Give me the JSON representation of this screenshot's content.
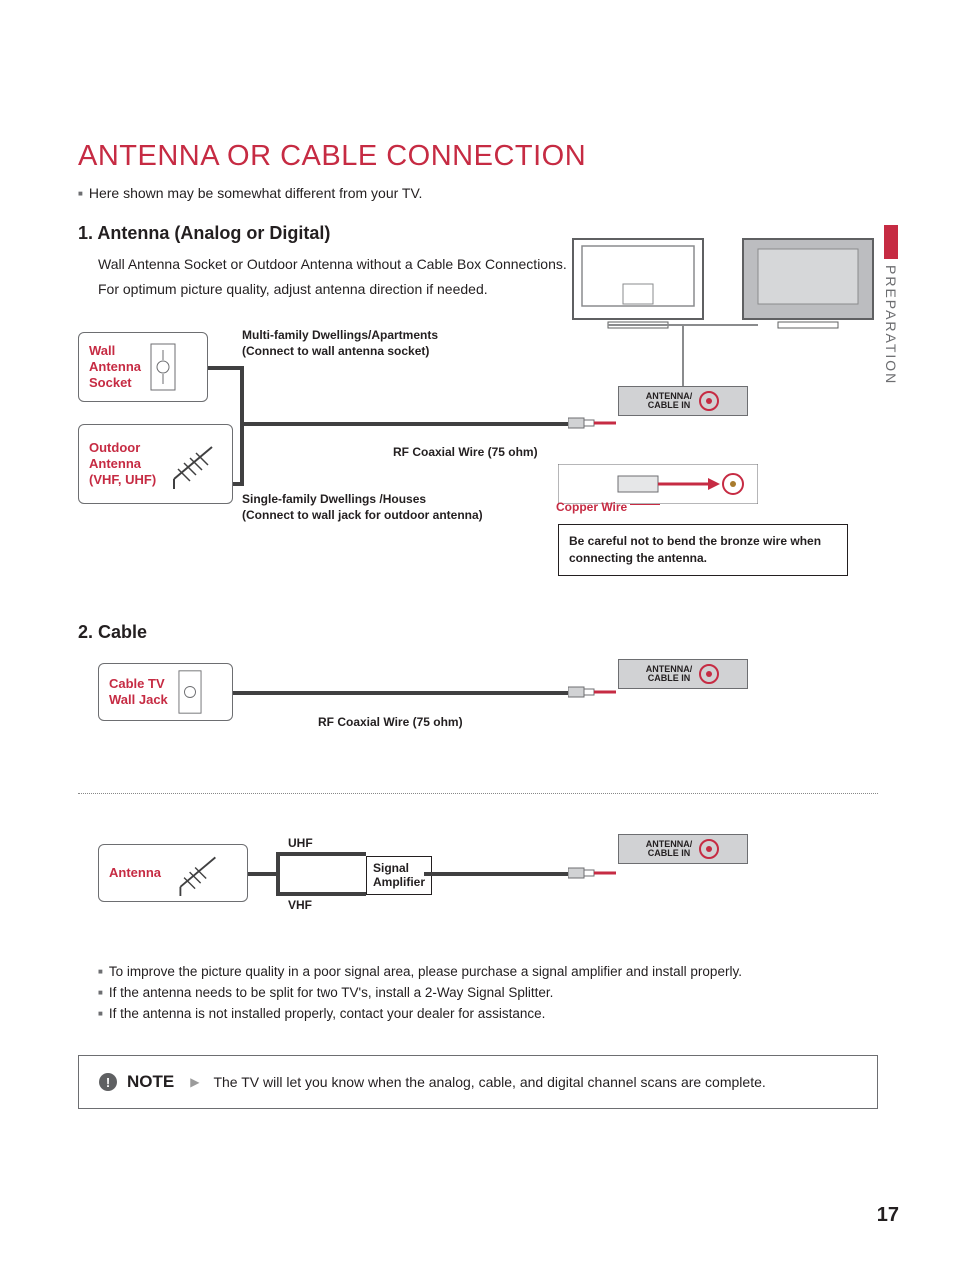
{
  "sideTab": "PREPARATION",
  "pageNumber": "17",
  "title": "ANTENNA OR CABLE CONNECTION",
  "intro": "Here shown may be somewhat different from your TV.",
  "section1": {
    "heading": "1. Antenna (Analog or Digital)",
    "p1": "Wall Antenna Socket or Outdoor Antenna without a Cable Box Connections.",
    "p2": "For optimum picture quality, adjust antenna direction if needed.",
    "labels": {
      "wallSocket": "Wall\nAntenna\nSocket",
      "outdoor": "Outdoor\nAntenna\n(VHF, UHF)",
      "multi": "Multi-family Dwellings/Apartments\n(Connect to wall antenna socket)",
      "single": "Single-family Dwellings /Houses\n(Connect to wall jack for outdoor antenna)",
      "rf": "RF Coaxial Wire (75 ohm)",
      "port": "ANTENNA/\nCABLE IN",
      "copper": "Copper Wire",
      "warning": "Be careful not to bend the bronze wire when connecting the antenna."
    }
  },
  "section2": {
    "heading": "2. Cable",
    "labels": {
      "jack": "Cable TV\nWall Jack",
      "rf": "RF Coaxial Wire (75 ohm)",
      "port": "ANTENNA/\nCABLE IN"
    }
  },
  "section3": {
    "labels": {
      "antenna": "Antenna",
      "uhf": "UHF",
      "vhf": "VHF",
      "amp": "Signal\nAmplifier",
      "port": "ANTENNA/\nCABLE IN"
    },
    "bullets": [
      "To improve the picture quality in a poor signal area, please purchase a signal amplifier and install properly.",
      "If the antenna needs to be split for two TV's, install a 2-Way Signal Splitter.",
      "If the antenna is not installed properly, contact your dealer for assistance."
    ]
  },
  "note": {
    "label": "NOTE",
    "text": "The TV will let you know when the analog, cable, and digital channel scans are complete."
  }
}
